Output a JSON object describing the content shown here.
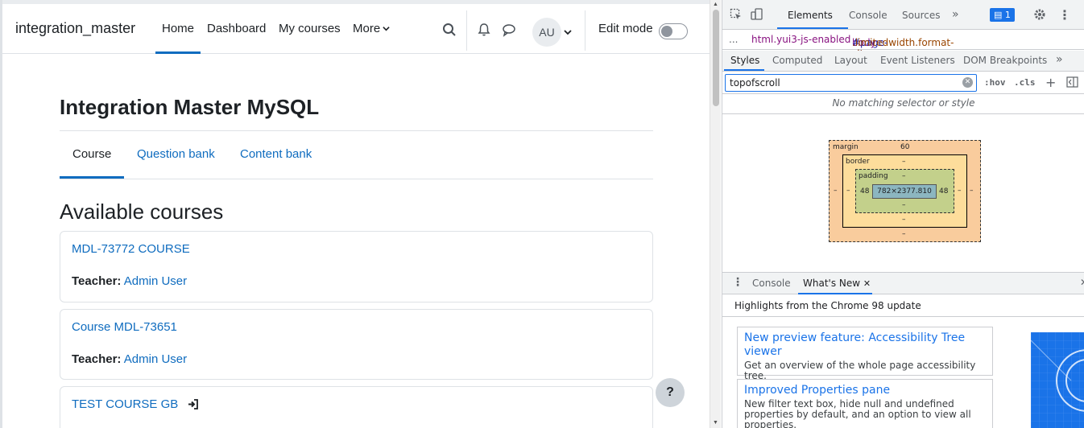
{
  "navbar": {
    "brand": "integration_master",
    "items": [
      {
        "label": "Home",
        "active": true
      },
      {
        "label": "Dashboard"
      },
      {
        "label": "My courses"
      },
      {
        "label": "More"
      }
    ],
    "user_initials": "AU",
    "edit_mode_label": "Edit mode"
  },
  "page": {
    "title": "Integration Master MySQL",
    "tabs": [
      {
        "label": "Course",
        "active": true
      },
      {
        "label": "Question bank"
      },
      {
        "label": "Content bank"
      }
    ],
    "section_title": "Available courses",
    "courses": [
      {
        "name": "MDL-73772 COURSE",
        "teacher_label": "Teacher:",
        "teacher": "Admin User"
      },
      {
        "name": "Course MDL-73651",
        "teacher_label": "Teacher:",
        "teacher": "Admin User"
      },
      {
        "name": "TEST COURSE GB"
      }
    ],
    "help_label": "?"
  },
  "devtools": {
    "tabs": [
      "Elements",
      "Console",
      "Sources"
    ],
    "active_tab": "Elements",
    "more_tabs": "»",
    "issues_count": "1",
    "breadcrumbs": {
      "ellipsis": "...",
      "html": "html.yui3-js-enabled",
      "body_tag": "body",
      "body_id": "#page-site-index",
      "body_classes": ".limitedwidth.format-site.cou"
    },
    "subtabs": [
      "Styles",
      "Computed",
      "Layout",
      "Event Listeners",
      "DOM Breakpoints"
    ],
    "active_subtab": "Styles",
    "filter_value": "topofscroll",
    "hov_label": ":hov",
    "cls_label": ".cls",
    "no_match": "No matching selector or style",
    "box_model": {
      "margin_label": "margin",
      "margin_top": "60",
      "margin_bottom": "–",
      "margin_left": "–",
      "margin_right": "–",
      "border_label": "border",
      "border_top": "–",
      "border_bottom": "–",
      "border_left": "–",
      "border_right": "–",
      "padding_label": "padding",
      "padding_top": "–",
      "padding_bottom": "–",
      "padding_left": "48",
      "padding_right": "48",
      "content": "782×2377.810"
    },
    "drawer": {
      "tabs": [
        "Console",
        "What's New"
      ],
      "active_tab": "What's New",
      "highlights": "Highlights from the Chrome 98 update",
      "cards": [
        {
          "title": "New preview feature: Accessibility Tree viewer",
          "desc": "Get an overview of the whole page accessibility tree."
        },
        {
          "title": "Improved Properties pane",
          "desc": "New filter text box, hide null and undefined properties by default, and an option to view all properties."
        }
      ]
    }
  },
  "colors": {
    "link": "#0f6cbf",
    "devtools_accent": "#1a73e8"
  }
}
